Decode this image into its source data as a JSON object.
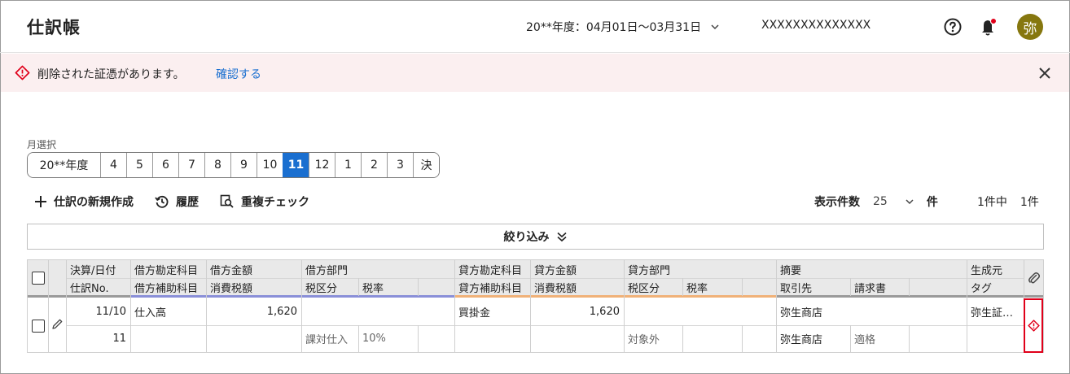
{
  "header": {
    "title": "仕訳帳",
    "fiscal_period": "20**年度：04月01日〜03月31日",
    "company": "XXXXXXXXXXXXXX",
    "avatar": "弥"
  },
  "notice": {
    "message": "削除された証憑があります。",
    "link": "確認する"
  },
  "month_selector": {
    "label": "月選択",
    "items": [
      "20**年度",
      "4",
      "5",
      "6",
      "7",
      "8",
      "9",
      "10",
      "11",
      "12",
      "1",
      "2",
      "3",
      "決"
    ],
    "selected": "11"
  },
  "toolbar": {
    "new_label": "仕訳の新規作成",
    "history_label": "履歴",
    "duplicate_label": "重複チェック"
  },
  "pagination": {
    "display_count_label": "表示件数",
    "display_count": "25",
    "unit": "件",
    "total_prefix": "1件中",
    "total_suffix": "1件"
  },
  "filter": {
    "label": "絞り込み"
  },
  "table": {
    "headers_row1": {
      "date": "決算/日付",
      "debit_account": "借方勘定科目",
      "debit_amount": "借方金額",
      "debit_dept": "借方部門",
      "credit_account": "貸方勘定科目",
      "credit_amount": "貸方金額",
      "credit_dept": "貸方部門",
      "summary": "摘要",
      "source": "生成元"
    },
    "headers_row2": {
      "no": "仕訳No.",
      "debit_sub": "借方補助科目",
      "debit_tax": "消費税額",
      "debit_tax_cat": "税区分",
      "debit_tax_rate": "税率",
      "credit_sub": "貸方補助科目",
      "credit_tax": "消費税額",
      "credit_tax_cat": "税区分",
      "credit_tax_rate": "税率",
      "partner": "取引先",
      "invoice": "請求書",
      "tag": "タグ"
    },
    "row": {
      "date": "11/10",
      "no": "11",
      "debit_account": "仕入高",
      "debit_amount": "1,620",
      "debit_tax_cat": "課対仕入",
      "debit_tax_rate": "10%",
      "credit_account": "買掛金",
      "credit_amount": "1,620",
      "credit_tax_cat": "対象外",
      "summary": "弥生商店",
      "partner": "弥生商店",
      "invoice": "適格",
      "source": "弥生証…"
    }
  },
  "colors": {
    "accent": "#1a6fd0",
    "debit_line": "#8a8fd8",
    "credit_line": "#f0b178",
    "error": "#e0001a",
    "avatar_bg": "#86770f"
  }
}
